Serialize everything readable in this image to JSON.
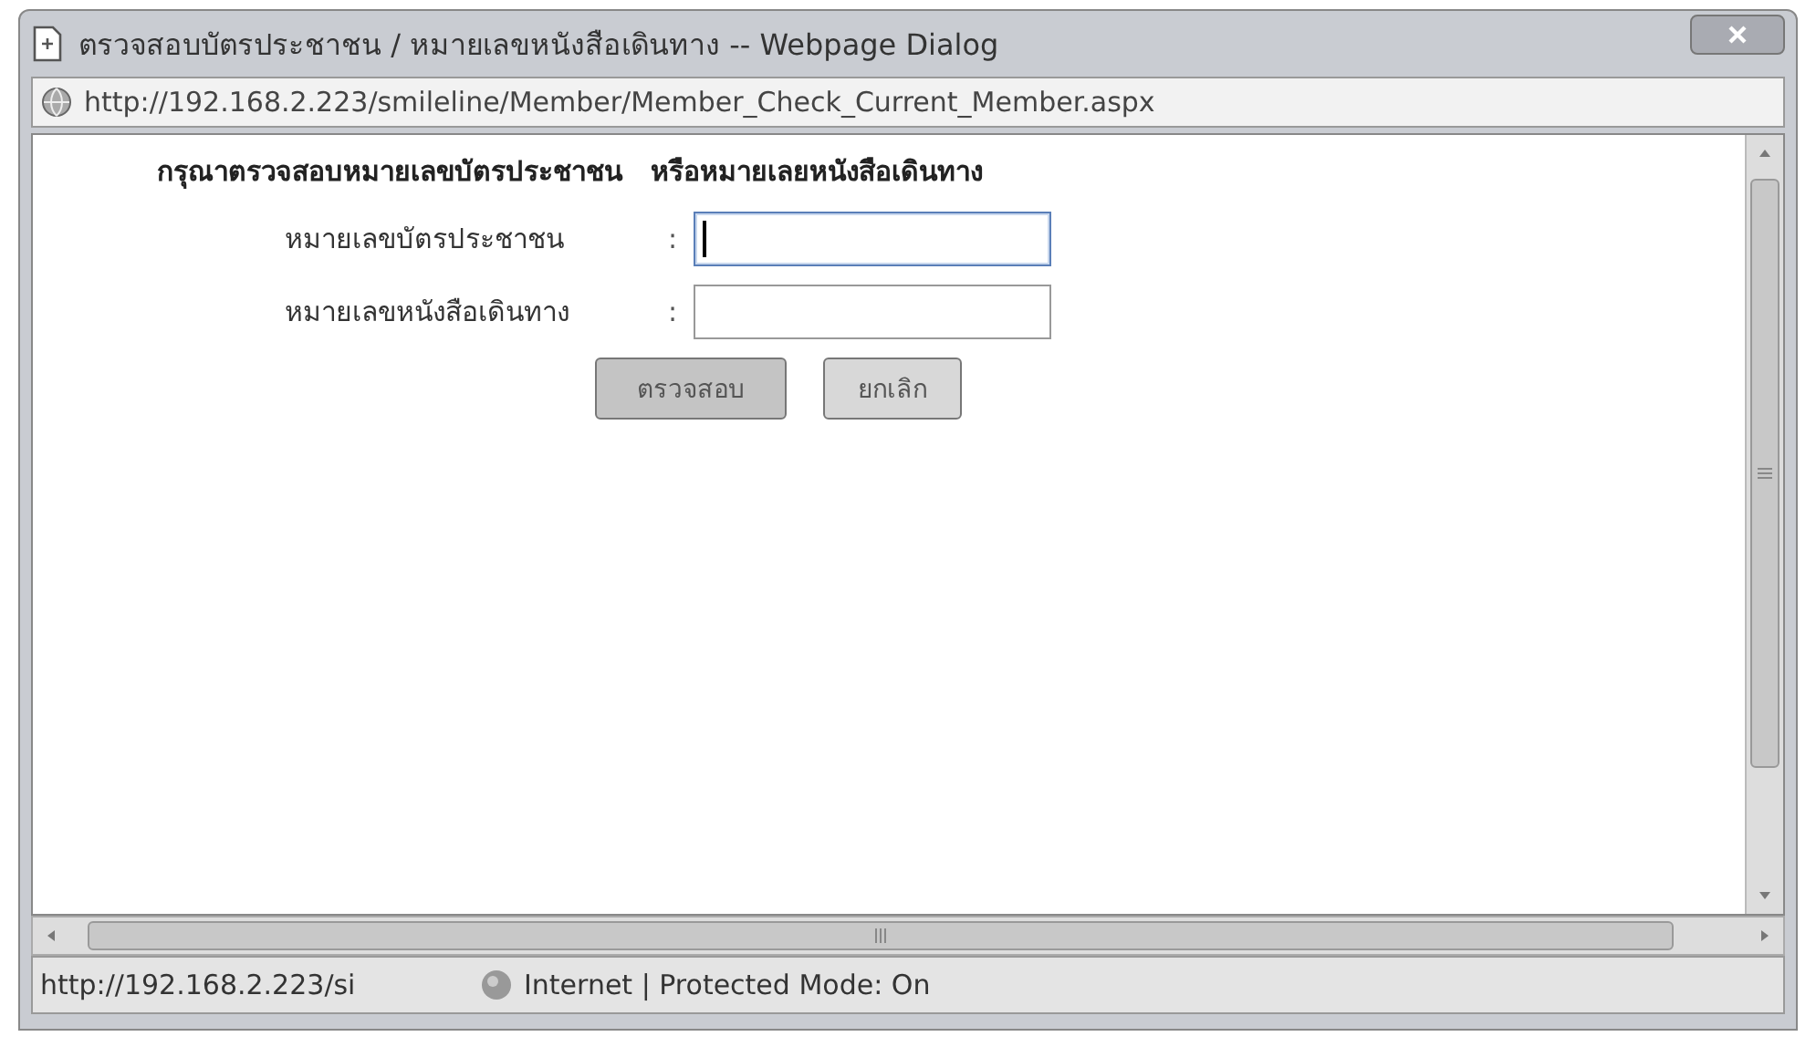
{
  "window": {
    "title": "ตรวจสอบบัตรประชาชน / หมายเลขหนังสือเดินทาง -- Webpage Dialog"
  },
  "address": "http://192.168.2.223/smileline/Member/Member_Check_Current_Member.aspx",
  "form": {
    "heading": "กรุณาตรวจสอบหมายเลขบัตรประชาชน   หรือหมายเลยหนังสือเดินทาง",
    "fields": [
      {
        "label": "หมายเลขบัตรประชาชน",
        "separator": ":",
        "focused": true
      },
      {
        "label": "หมายเลขหนังสือเดินทาง",
        "separator": ":",
        "focused": false
      }
    ],
    "buttons": [
      "ตรวจสอบ",
      "ยกเลิก"
    ]
  },
  "status_bar": {
    "url": "http://192.168.2.223/si",
    "zone": "Internet | Protected Mode: On"
  }
}
